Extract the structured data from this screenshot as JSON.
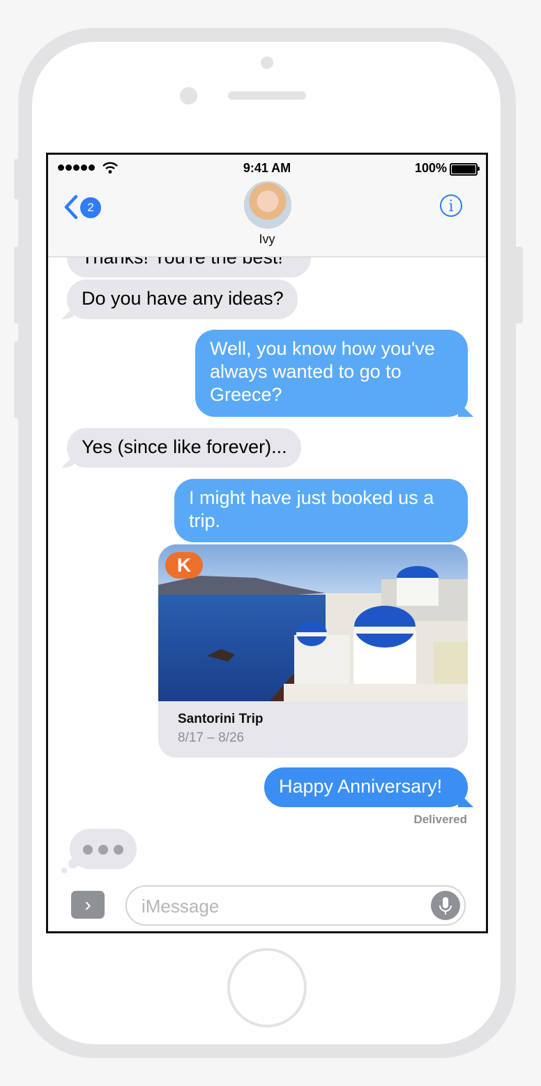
{
  "status_bar": {
    "time": "9:41 AM",
    "battery": "100%"
  },
  "header": {
    "back_badge": "2",
    "contact_name": "Ivy",
    "info_glyph": "i"
  },
  "messages": [
    {
      "direction": "incoming",
      "text": "Thanks! You're the best!"
    },
    {
      "direction": "incoming",
      "text": "Do you have any ideas?"
    },
    {
      "direction": "outgoing",
      "text": "Well, you know how you've always wanted to go to Greece?"
    },
    {
      "direction": "incoming",
      "text": "Yes (since like forever)..."
    },
    {
      "direction": "outgoing",
      "text": "I might have just booked us a trip."
    },
    {
      "direction": "outgoing",
      "text": "Happy Anniversary!"
    }
  ],
  "card": {
    "logo_letter": "K",
    "title": "Santorini Trip",
    "dates": "8/17 – 8/26"
  },
  "delivery_status": "Delivered",
  "composer": {
    "placeholder": "iMessage",
    "expand_glyph": "›"
  },
  "icons": {
    "back": "chevron-left-icon",
    "info": "info-icon",
    "mic": "microphone-icon",
    "expand": "chevron-right-icon",
    "wifi": "wifi-icon",
    "battery": "battery-icon"
  },
  "colors": {
    "accent": "#2f7cf6",
    "outgoing_bubble": "#5aa9f7",
    "outgoing_bubble_last": "#3b8ef3",
    "incoming_bubble": "#e6e6eb",
    "card_logo": "#ee6f2b"
  }
}
